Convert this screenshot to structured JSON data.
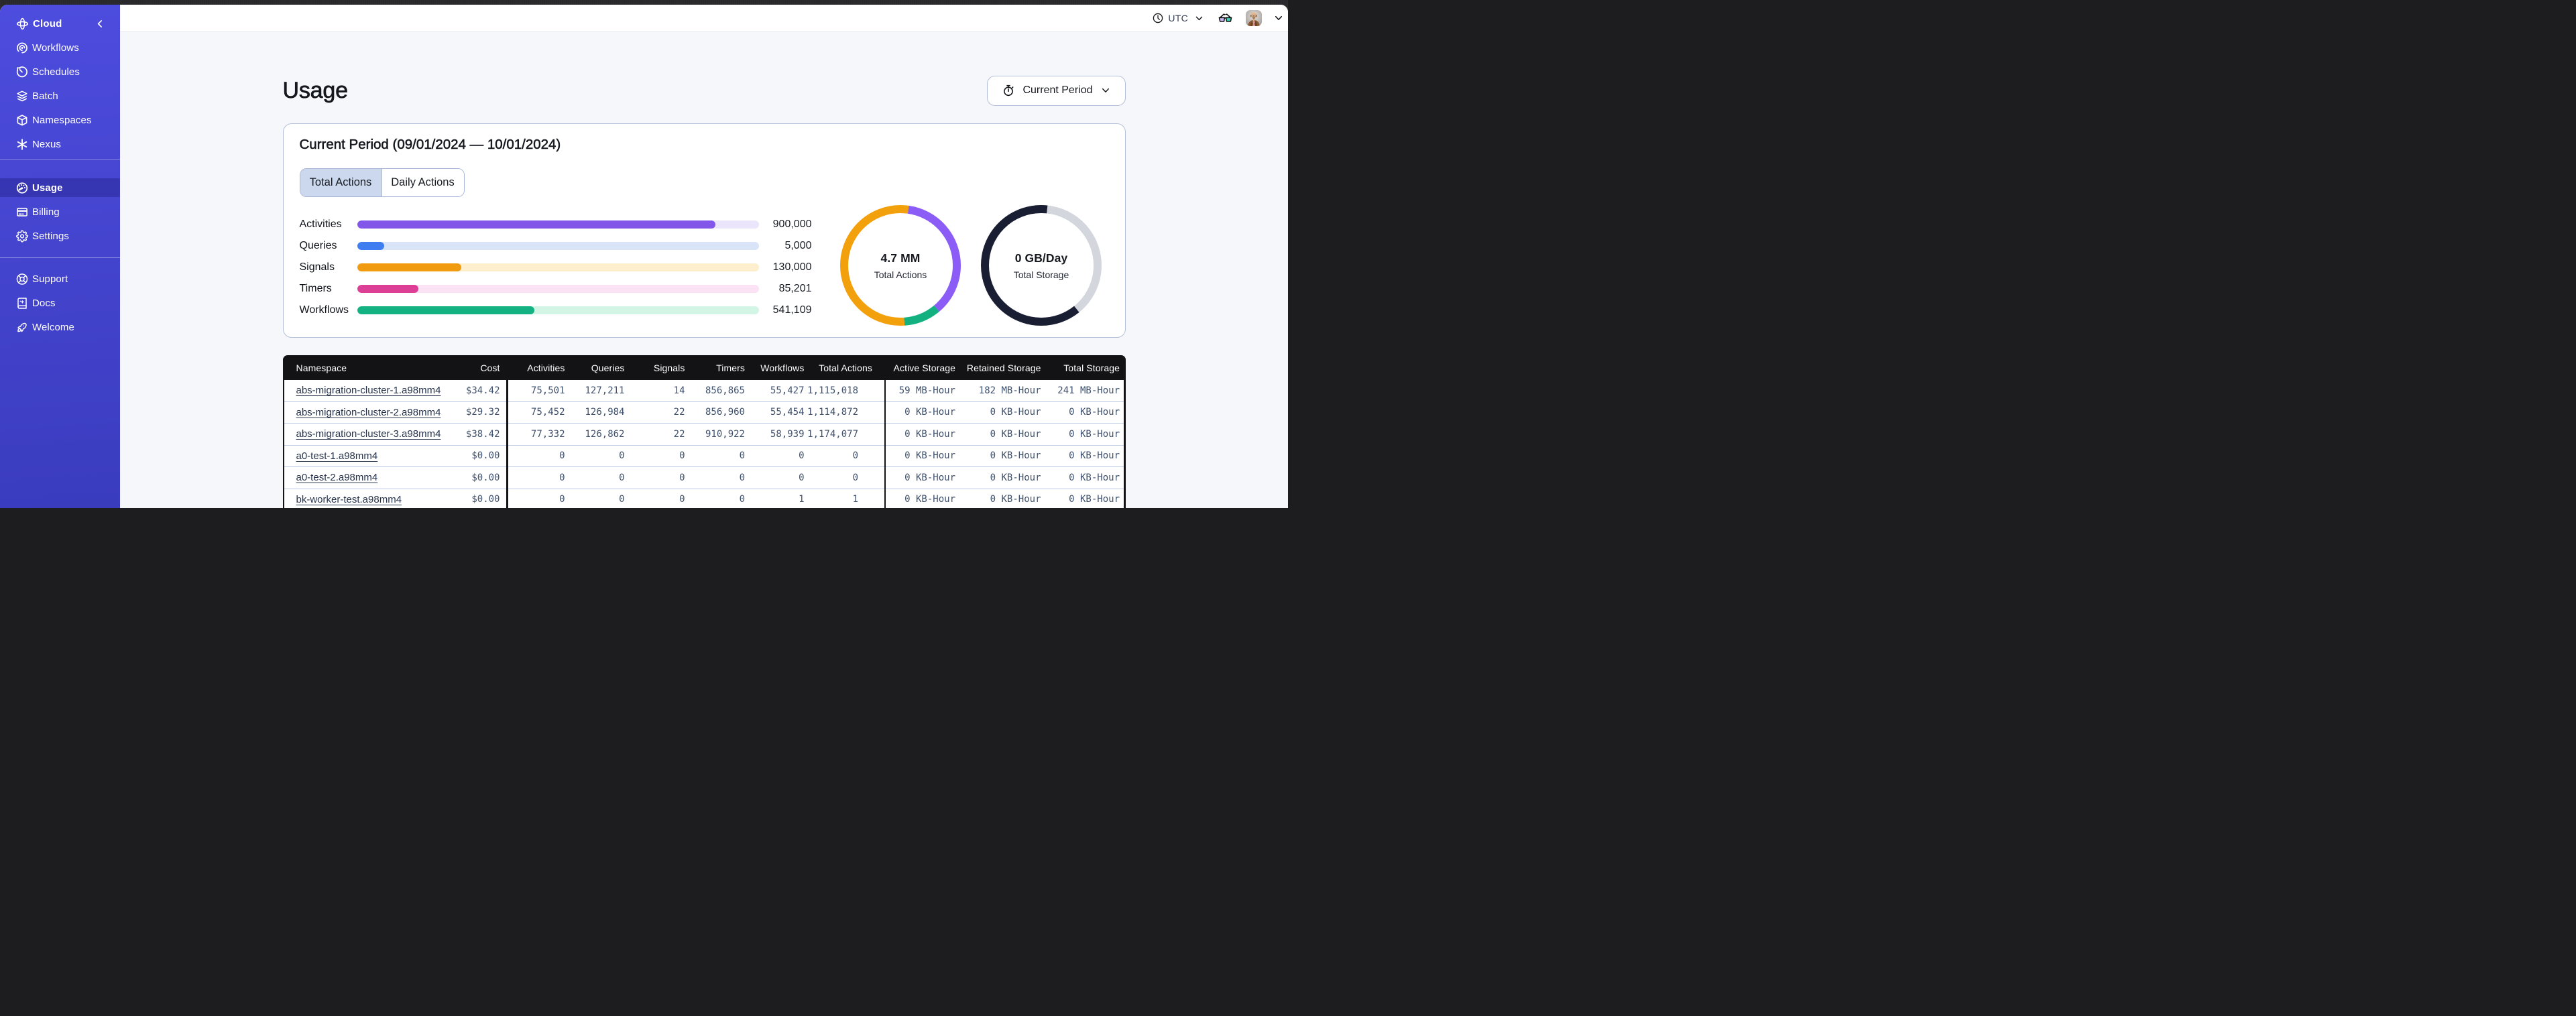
{
  "sidebar": {
    "brand": {
      "label": "Cloud",
      "logo_icon": "temporal-cloud-logo",
      "collapse_icon": "chevron-left"
    },
    "nav_main": [
      {
        "label": "Workflows",
        "icon": "workflows-spiral-icon"
      },
      {
        "label": "Schedules",
        "icon": "schedules-clock-icon"
      },
      {
        "label": "Batch",
        "icon": "batch-layers-icon"
      },
      {
        "label": "Namespaces",
        "icon": "namespaces-cube-icon"
      },
      {
        "label": "Nexus",
        "icon": "nexus-asterisk-icon"
      }
    ],
    "nav_account": [
      {
        "label": "Usage",
        "icon": "usage-gauge-icon",
        "active": true
      },
      {
        "label": "Billing",
        "icon": "billing-card-icon"
      },
      {
        "label": "Settings",
        "icon": "settings-gear-icon"
      }
    ],
    "nav_footer": [
      {
        "label": "Support",
        "icon": "support-lifebuoy-icon"
      },
      {
        "label": "Docs",
        "icon": "docs-book-icon"
      },
      {
        "label": "Welcome",
        "icon": "welcome-rocket-icon"
      }
    ],
    "colors": {
      "background_top": "#4d49dc",
      "background_bottom": "#3c3abf",
      "active_item": "rgba(16,12,96,0.28)"
    }
  },
  "topbar": {
    "timezone": {
      "icon": "clock-icon",
      "label": "UTC",
      "chevron": "chevron-down"
    },
    "incognito": {
      "icon": "glasses-icon",
      "lens_left_color": "#c9b6f3",
      "lens_right_color": "#45cdb4"
    },
    "account": {
      "avatar": "user-avatar-photo",
      "chevron": "chevron-down"
    }
  },
  "page": {
    "title": "Usage",
    "period_button": {
      "icon": "stopwatch-icon",
      "label": "Current Period",
      "chevron": "chevron-down"
    }
  },
  "usage_card": {
    "title": "Current Period (09/01/2024 — 10/01/2024)",
    "tabs": [
      {
        "label": "Total Actions",
        "active": true
      },
      {
        "label": "Daily Actions",
        "active": false
      }
    ]
  },
  "chart_data": [
    {
      "type": "bar",
      "orientation": "horizontal",
      "categories": [
        "Activities",
        "Queries",
        "Signals",
        "Timers",
        "Workflows"
      ],
      "values": [
        900000,
        5000,
        130000,
        85201,
        541109
      ],
      "display_values": [
        "900,000",
        "5,000",
        "130,000",
        "85,201",
        "541,109"
      ],
      "percent_filled": [
        89.3,
        6.7,
        25.9,
        15.3,
        44.1
      ],
      "bar_colors": [
        "#8156e8",
        "#3e7ef0",
        "#f09b10",
        "#dd3f96",
        "#14b183"
      ],
      "track_colors": [
        "#eae5fb",
        "#d9e4f9",
        "#fdefcd",
        "#fbe2f4",
        "#d3f5e6"
      ],
      "grid": false,
      "legend": false
    },
    {
      "type": "donut",
      "title": "4.7 MM",
      "subtitle": "Total Actions",
      "segments": [
        {
          "name": "activities",
          "color": "#8b5cf6",
          "start_deg": 8,
          "end_deg": 140
        },
        {
          "name": "workflows",
          "color": "#12b17f",
          "start_deg": 140,
          "end_deg": 176
        },
        {
          "name": "signals",
          "color": "#f2a10d",
          "start_deg": 176,
          "end_deg": 368
        }
      ],
      "ring_width": 12,
      "legend": false
    },
    {
      "type": "donut",
      "title": "0 GB/Day",
      "subtitle": "Total Storage",
      "segments": [
        {
          "name": "retained",
          "color": "#d3d6dd",
          "start_deg": 6,
          "end_deg": 141
        },
        {
          "name": "active",
          "color": "#191e32",
          "start_deg": 141,
          "end_deg": 366
        }
      ],
      "ring_width": 12,
      "legend": false
    }
  ],
  "table": {
    "columns": [
      "Namespace",
      "Cost",
      "Activities",
      "Queries",
      "Signals",
      "Timers",
      "Workflows",
      "Total Actions",
      "Active Storage",
      "Retained Storage",
      "Total Storage"
    ],
    "rows": [
      {
        "namespace": "abs-migration-cluster-1.a98mm4",
        "cost": "$34.42",
        "activities": "75,501",
        "queries": "127,211",
        "signals": "14",
        "timers": "856,865",
        "workflows": "55,427",
        "total_actions": "1,115,018",
        "active_storage": "59 MB-Hour",
        "retained_storage": "182 MB-Hour",
        "total_storage": "241 MB-Hour"
      },
      {
        "namespace": "abs-migration-cluster-2.a98mm4",
        "cost": "$29.32",
        "activities": "75,452",
        "queries": "126,984",
        "signals": "22",
        "timers": "856,960",
        "workflows": "55,454",
        "total_actions": "1,114,872",
        "active_storage": "0 KB-Hour",
        "retained_storage": "0 KB-Hour",
        "total_storage": "0 KB-Hour"
      },
      {
        "namespace": "abs-migration-cluster-3.a98mm4",
        "cost": "$38.42",
        "activities": "77,332",
        "queries": "126,862",
        "signals": "22",
        "timers": "910,922",
        "workflows": "58,939",
        "total_actions": "1,174,077",
        "active_storage": "0 KB-Hour",
        "retained_storage": "0 KB-Hour",
        "total_storage": "0 KB-Hour"
      },
      {
        "namespace": "a0-test-1.a98mm4",
        "cost": "$0.00",
        "activities": "0",
        "queries": "0",
        "signals": "0",
        "timers": "0",
        "workflows": "0",
        "total_actions": "0",
        "active_storage": "0 KB-Hour",
        "retained_storage": "0 KB-Hour",
        "total_storage": "0 KB-Hour"
      },
      {
        "namespace": "a0-test-2.a98mm4",
        "cost": "$0.00",
        "activities": "0",
        "queries": "0",
        "signals": "0",
        "timers": "0",
        "workflows": "0",
        "total_actions": "0",
        "active_storage": "0 KB-Hour",
        "retained_storage": "0 KB-Hour",
        "total_storage": "0 KB-Hour"
      },
      {
        "namespace": "bk-worker-test.a98mm4",
        "cost": "$0.00",
        "activities": "0",
        "queries": "0",
        "signals": "0",
        "timers": "0",
        "workflows": "1",
        "total_actions": "1",
        "active_storage": "0 KB-Hour",
        "retained_storage": "0 KB-Hour",
        "total_storage": "0 KB-Hour"
      }
    ],
    "header_background": "#131316",
    "row_divider_color": "#bfcbe4"
  }
}
